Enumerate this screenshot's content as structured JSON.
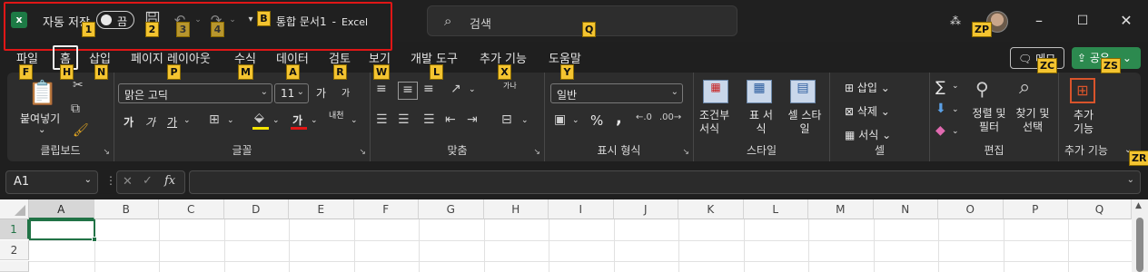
{
  "titlebar": {
    "autosave_label": "자동 저장",
    "autosave_state": "끔",
    "doc_title": "통합 문서1",
    "app_name": "Excel",
    "search_placeholder": "검색",
    "keytips": {
      "k1": "1",
      "k2": "2",
      "k3": "3",
      "k4": "4",
      "kb": "B",
      "kq": "Q",
      "kzp": "ZP"
    }
  },
  "tabs": [
    {
      "label": "파일",
      "keytip": "F"
    },
    {
      "label": "홈",
      "keytip": "H"
    },
    {
      "label": "삽입",
      "keytip": "N"
    },
    {
      "label": "페이지 레이아웃",
      "keytip": "P"
    },
    {
      "label": "수식",
      "keytip": "M"
    },
    {
      "label": "데이터",
      "keytip": "A"
    },
    {
      "label": "검토",
      "keytip": "R"
    },
    {
      "label": "보기",
      "keytip": "W"
    },
    {
      "label": "개발 도구",
      "keytip": "L"
    },
    {
      "label": "추가 기능",
      "keytip": "X"
    },
    {
      "label": "도움말",
      "keytip": "Y"
    }
  ],
  "memo": {
    "label": "메모",
    "keytip": "ZC"
  },
  "share": {
    "label": "공유",
    "keytip": "ZS"
  },
  "ribbon": {
    "clipboard": {
      "paste": "붙여넣기",
      "label": "클립보드"
    },
    "font": {
      "name": "맑은 고딕",
      "size": "11",
      "label": "글꼴",
      "grow": "가",
      "shrink": "가",
      "bold": "가",
      "italic": "가",
      "underline": "가",
      "font_color": "가",
      "phonetic": "내천"
    },
    "alignment": {
      "label": "맞춤",
      "wrap": "가나"
    },
    "number": {
      "format": "일반",
      "label": "표시 형식",
      "percent": "%",
      "comma": ","
    },
    "styles": {
      "conditional": "조건부 서식",
      "table": "표 서식",
      "cell": "셀 스타일",
      "label": "스타일"
    },
    "cells": {
      "insert": "삽입",
      "delete": "삭제",
      "format": "서식",
      "label": "셀"
    },
    "editing": {
      "sort": "정렬 및 필터",
      "find": "찾기 및 선택",
      "label": "편집",
      "sigma": "∑"
    },
    "addins": {
      "button": "추가 기능",
      "label": "추가 기능",
      "keytip": "ZR"
    }
  },
  "formula_bar": {
    "namebox": "A1",
    "fx": "fx",
    "value": ""
  },
  "sheet": {
    "columns": [
      "A",
      "B",
      "C",
      "D",
      "E",
      "F",
      "G",
      "H",
      "I",
      "J",
      "K",
      "L",
      "M",
      "N",
      "O",
      "P",
      "Q"
    ],
    "rows": [
      "1",
      "2"
    ],
    "active_cell": "A1"
  }
}
